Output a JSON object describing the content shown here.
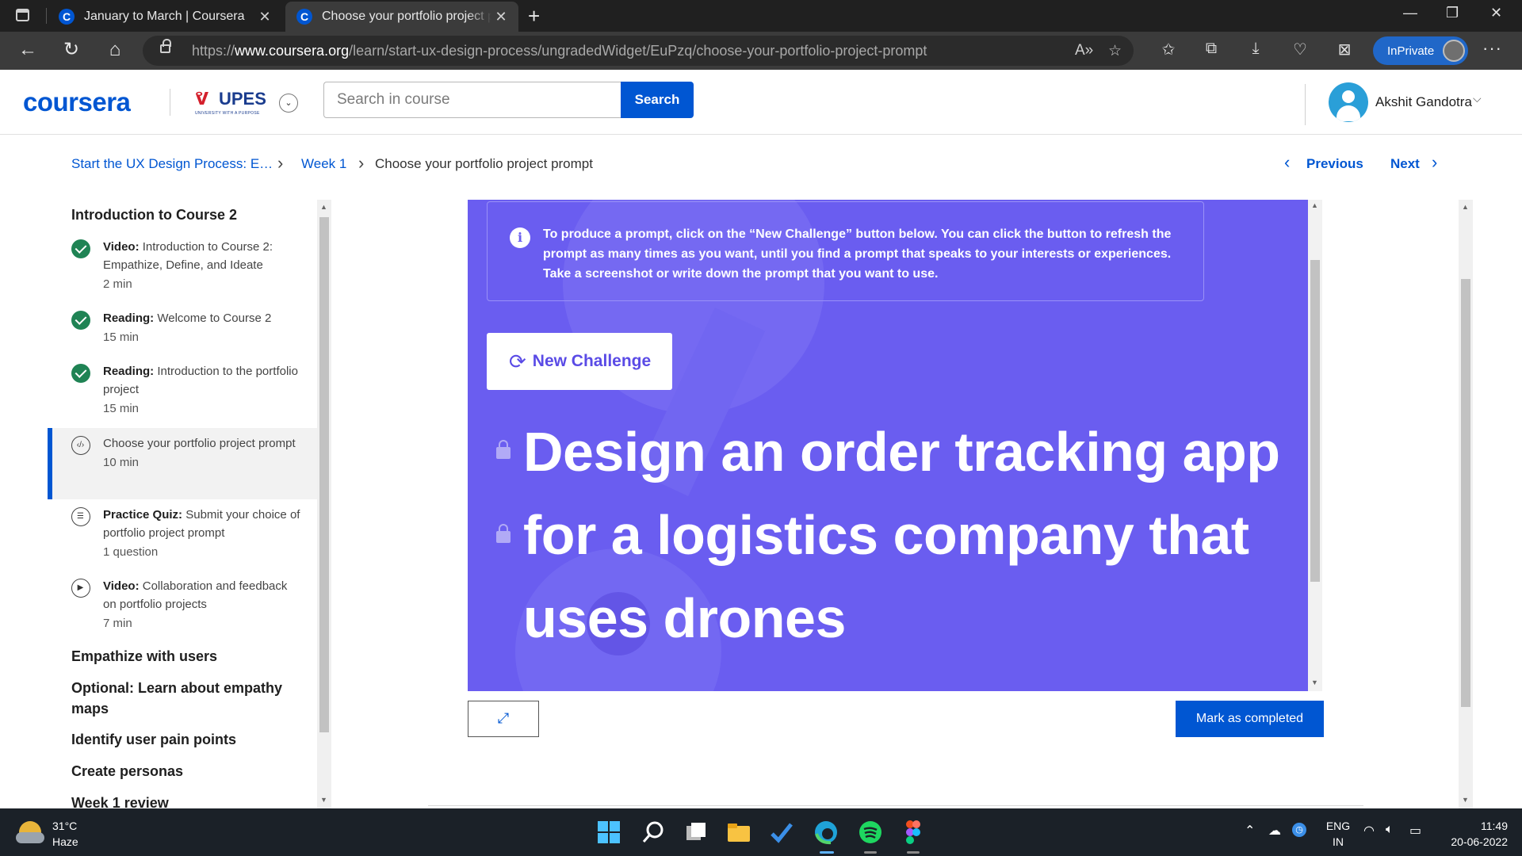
{
  "browser": {
    "tabs": [
      {
        "title": "January to March | Coursera",
        "favicon": "C"
      },
      {
        "title": "Choose your portfolio project prompt",
        "favicon": "C",
        "active": true
      }
    ],
    "url_prefix": "https://",
    "url_domain": "www.coursera.org",
    "url_path": "/learn/start-ux-design-process/ungradedWidget/EuPzq/choose-your-portfolio-project-prompt",
    "inprivate_label": "InPrivate"
  },
  "header": {
    "logo": "coursera",
    "partner": "UPES",
    "partner_tagline": "UNIVERSITY WITH A PURPOSE",
    "search_placeholder": "Search in course",
    "search_button": "Search",
    "user_name": "Akshit Gandotra"
  },
  "breadcrumb": {
    "course": "Start the UX Design Process: E…",
    "week": "Week 1",
    "current": "Choose your portfolio project prompt"
  },
  "pager": {
    "previous": "Previous",
    "next": "Next"
  },
  "sidebar": {
    "section_title": "Introduction to Course 2",
    "items": [
      {
        "type": "Video:",
        "title": "Introduction to Course 2: Empathize, Define, and Ideate",
        "duration": "2 min",
        "status": "done"
      },
      {
        "type": "Reading:",
        "title": "Welcome to Course 2",
        "duration": "15 min",
        "status": "done"
      },
      {
        "type": "Reading:",
        "title": "Introduction to the portfolio project",
        "duration": "15 min",
        "status": "done"
      },
      {
        "type": "",
        "title": "Choose your portfolio project prompt",
        "duration": "10 min",
        "status": "current"
      },
      {
        "type": "Practice Quiz:",
        "title": "Submit your choice of portfolio project prompt",
        "duration": "1 question",
        "status": "todo"
      },
      {
        "type": "Video:",
        "title": "Collaboration and feedback on portfolio projects",
        "duration": "7 min",
        "status": "todo"
      }
    ],
    "sections": [
      "Empathize with users",
      "Optional: Learn about empathy maps",
      "Identify user pain points",
      "Create personas",
      "Week 1 review"
    ]
  },
  "widget": {
    "instructions": "To produce a prompt, click on the “New Challenge” button below. You can click the button to refresh the prompt as many times as you want, until you find a prompt that speaks to your interests or experiences. Take a screenshot or write down the prompt that you want to use.",
    "new_challenge_label": "New Challenge",
    "prompt_lines": [
      "Design an order tracking app",
      "for a logistics company that",
      "uses drones"
    ],
    "accent_color": "#6a5df0"
  },
  "actions": {
    "mark_completed": "Mark as completed"
  },
  "taskbar": {
    "temperature": "31°C",
    "weather": "Haze",
    "language": "ENG",
    "region": "IN",
    "time": "11:49",
    "date": "20-06-2022"
  }
}
